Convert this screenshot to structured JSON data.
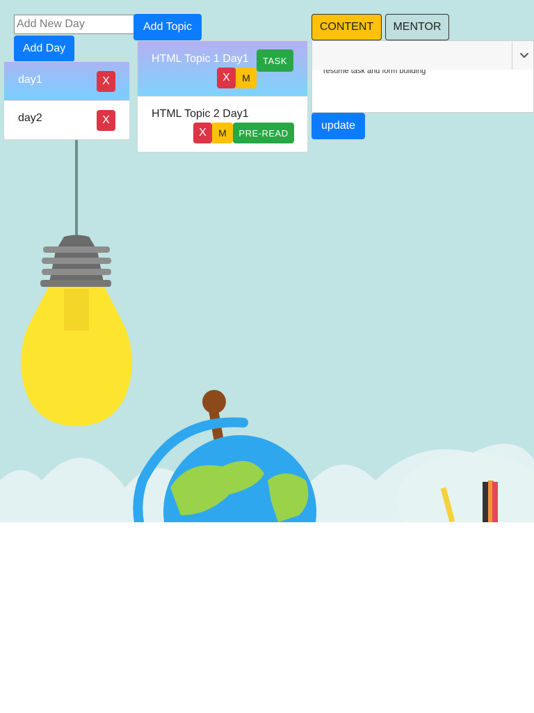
{
  "days_panel": {
    "input_placeholder": "Add New Day",
    "add_day_label": "Add Day",
    "items": [
      {
        "label": "day1",
        "delete_label": "X",
        "active": true
      },
      {
        "label": "day2",
        "delete_label": "X",
        "active": false
      }
    ]
  },
  "topics_panel": {
    "add_topic_label": "Add Topic",
    "items": [
      {
        "label": "HTML Topic 1 Day1",
        "type_badge": "TASK",
        "delete_label": "X",
        "modify_label": "M",
        "active": true
      },
      {
        "label": "HTML Topic 2 Day1",
        "type_badge": "PRE-READ",
        "delete_label": "X",
        "modify_label": "M",
        "active": false
      }
    ]
  },
  "editor_panel": {
    "tabs": [
      {
        "label": "CONTENT",
        "active": true,
        "color": "#ffc107"
      },
      {
        "label": "MENTOR",
        "active": false,
        "color": "#6c757d"
      }
    ],
    "select_value": "",
    "content_text": "resume task and form building",
    "update_label": "update"
  },
  "colors": {
    "primary": "#0d7bfd",
    "danger": "#dc3545",
    "warning": "#ffc107",
    "success": "#28a745",
    "background": "#c0e3e3"
  },
  "icons": {
    "select_chevron": "chevron-down-icon"
  }
}
